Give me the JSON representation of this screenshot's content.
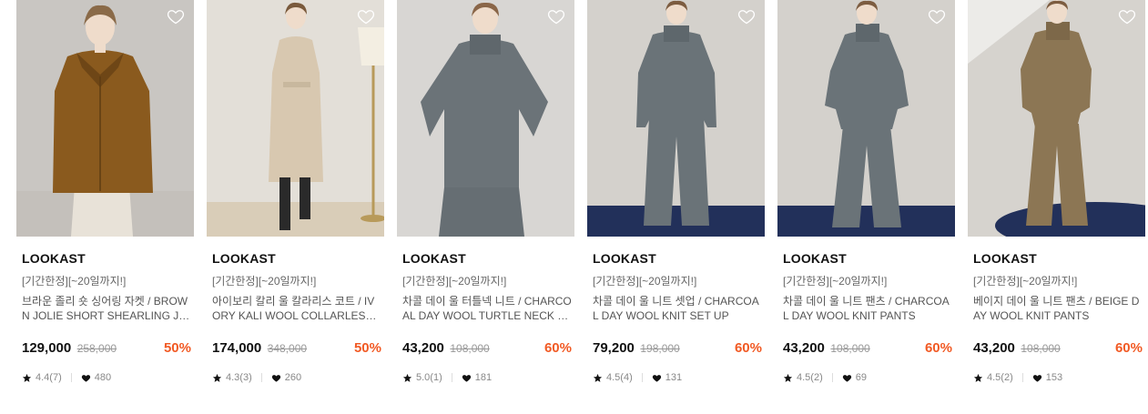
{
  "products": [
    {
      "brand": "LOOKAST",
      "promo": "[기간한정][~20일까지!]",
      "name": "브라운 졸리 숏 싱어링 자켓 / BROWN JOLIE SHORT SHEARLING JACKET",
      "price": "129,000",
      "original_price": "258,000",
      "discount": "50%",
      "rating": "4.4(7)",
      "likes": "480",
      "colors": {
        "bg": "#c9c6c2",
        "floor": "#c9c6c2",
        "top": "#8a5a1e",
        "bottom": "#e8e2d8",
        "hair": "#8a6a48"
      }
    },
    {
      "brand": "LOOKAST",
      "promo": "[기간한정][~20일까지!]",
      "name": "아이보리 칼리 울 칼라리스 코트 / IVORY KALI WOOL COLLARLESS COAT",
      "price": "174,000",
      "original_price": "348,000",
      "discount": "50%",
      "rating": "4.3(3)",
      "likes": "260",
      "colors": {
        "bg": "#e3dfd8",
        "floor": "#d9cdb8",
        "top": "#d8c8b0",
        "bottom": "#2a2a2a",
        "hair": "#7a5a3c"
      }
    },
    {
      "brand": "LOOKAST",
      "promo": "[기간한정][~20일까지!]",
      "name": "차콜 데이 울 터틀넥 니트 / CHARCOAL DAY WOOL TURTLE NECK KNIT",
      "price": "43,200",
      "original_price": "108,000",
      "discount": "60%",
      "rating": "5.0(1)",
      "likes": "181",
      "colors": {
        "bg": "#d8d6d3",
        "floor": "#d8d6d3",
        "top": "#6b7378",
        "bottom": "#6b7378",
        "hair": "#8a6648"
      }
    },
    {
      "brand": "LOOKAST",
      "promo": "[기간한정][~20일까지!]",
      "name": "차콜 데이 울 니트 셋업 / CHARCOAL DAY WOOL KNIT SET UP",
      "price": "79,200",
      "original_price": "198,000",
      "discount": "60%",
      "rating": "4.5(4)",
      "likes": "131",
      "colors": {
        "bg": "#d4d1cc",
        "floor": "#22305a",
        "top": "#6a7378",
        "bottom": "#6a7378",
        "hair": "#7c5c40"
      }
    },
    {
      "brand": "LOOKAST",
      "promo": "[기간한정][~20일까지!]",
      "name": "차콜 데이 울 니트 팬츠 / CHARCOAL DAY WOOL KNIT PANTS",
      "price": "43,200",
      "original_price": "108,000",
      "discount": "60%",
      "rating": "4.5(2)",
      "likes": "69",
      "colors": {
        "bg": "#d4d1cc",
        "floor": "#22305a",
        "top": "#6a7378",
        "bottom": "#6a7378",
        "hair": "#7c5c40"
      }
    },
    {
      "brand": "LOOKAST",
      "promo": "[기간한정][~20일까지!]",
      "name": "베이지 데이 울 니트 팬츠 / BEIGE DAY WOOL KNIT PANTS",
      "price": "43,200",
      "original_price": "108,000",
      "discount": "60%",
      "rating": "4.5(2)",
      "likes": "153",
      "colors": {
        "bg": "#d6d3ce",
        "floor": "#22305a",
        "top": "#8c7654",
        "bottom": "#8c7654",
        "hair": "#7c5c40"
      }
    }
  ],
  "icons": {
    "wishlist": "heart-outline-icon",
    "rating": "star-icon",
    "likes": "heart-filled-icon"
  },
  "accent_color": "#f15a24"
}
